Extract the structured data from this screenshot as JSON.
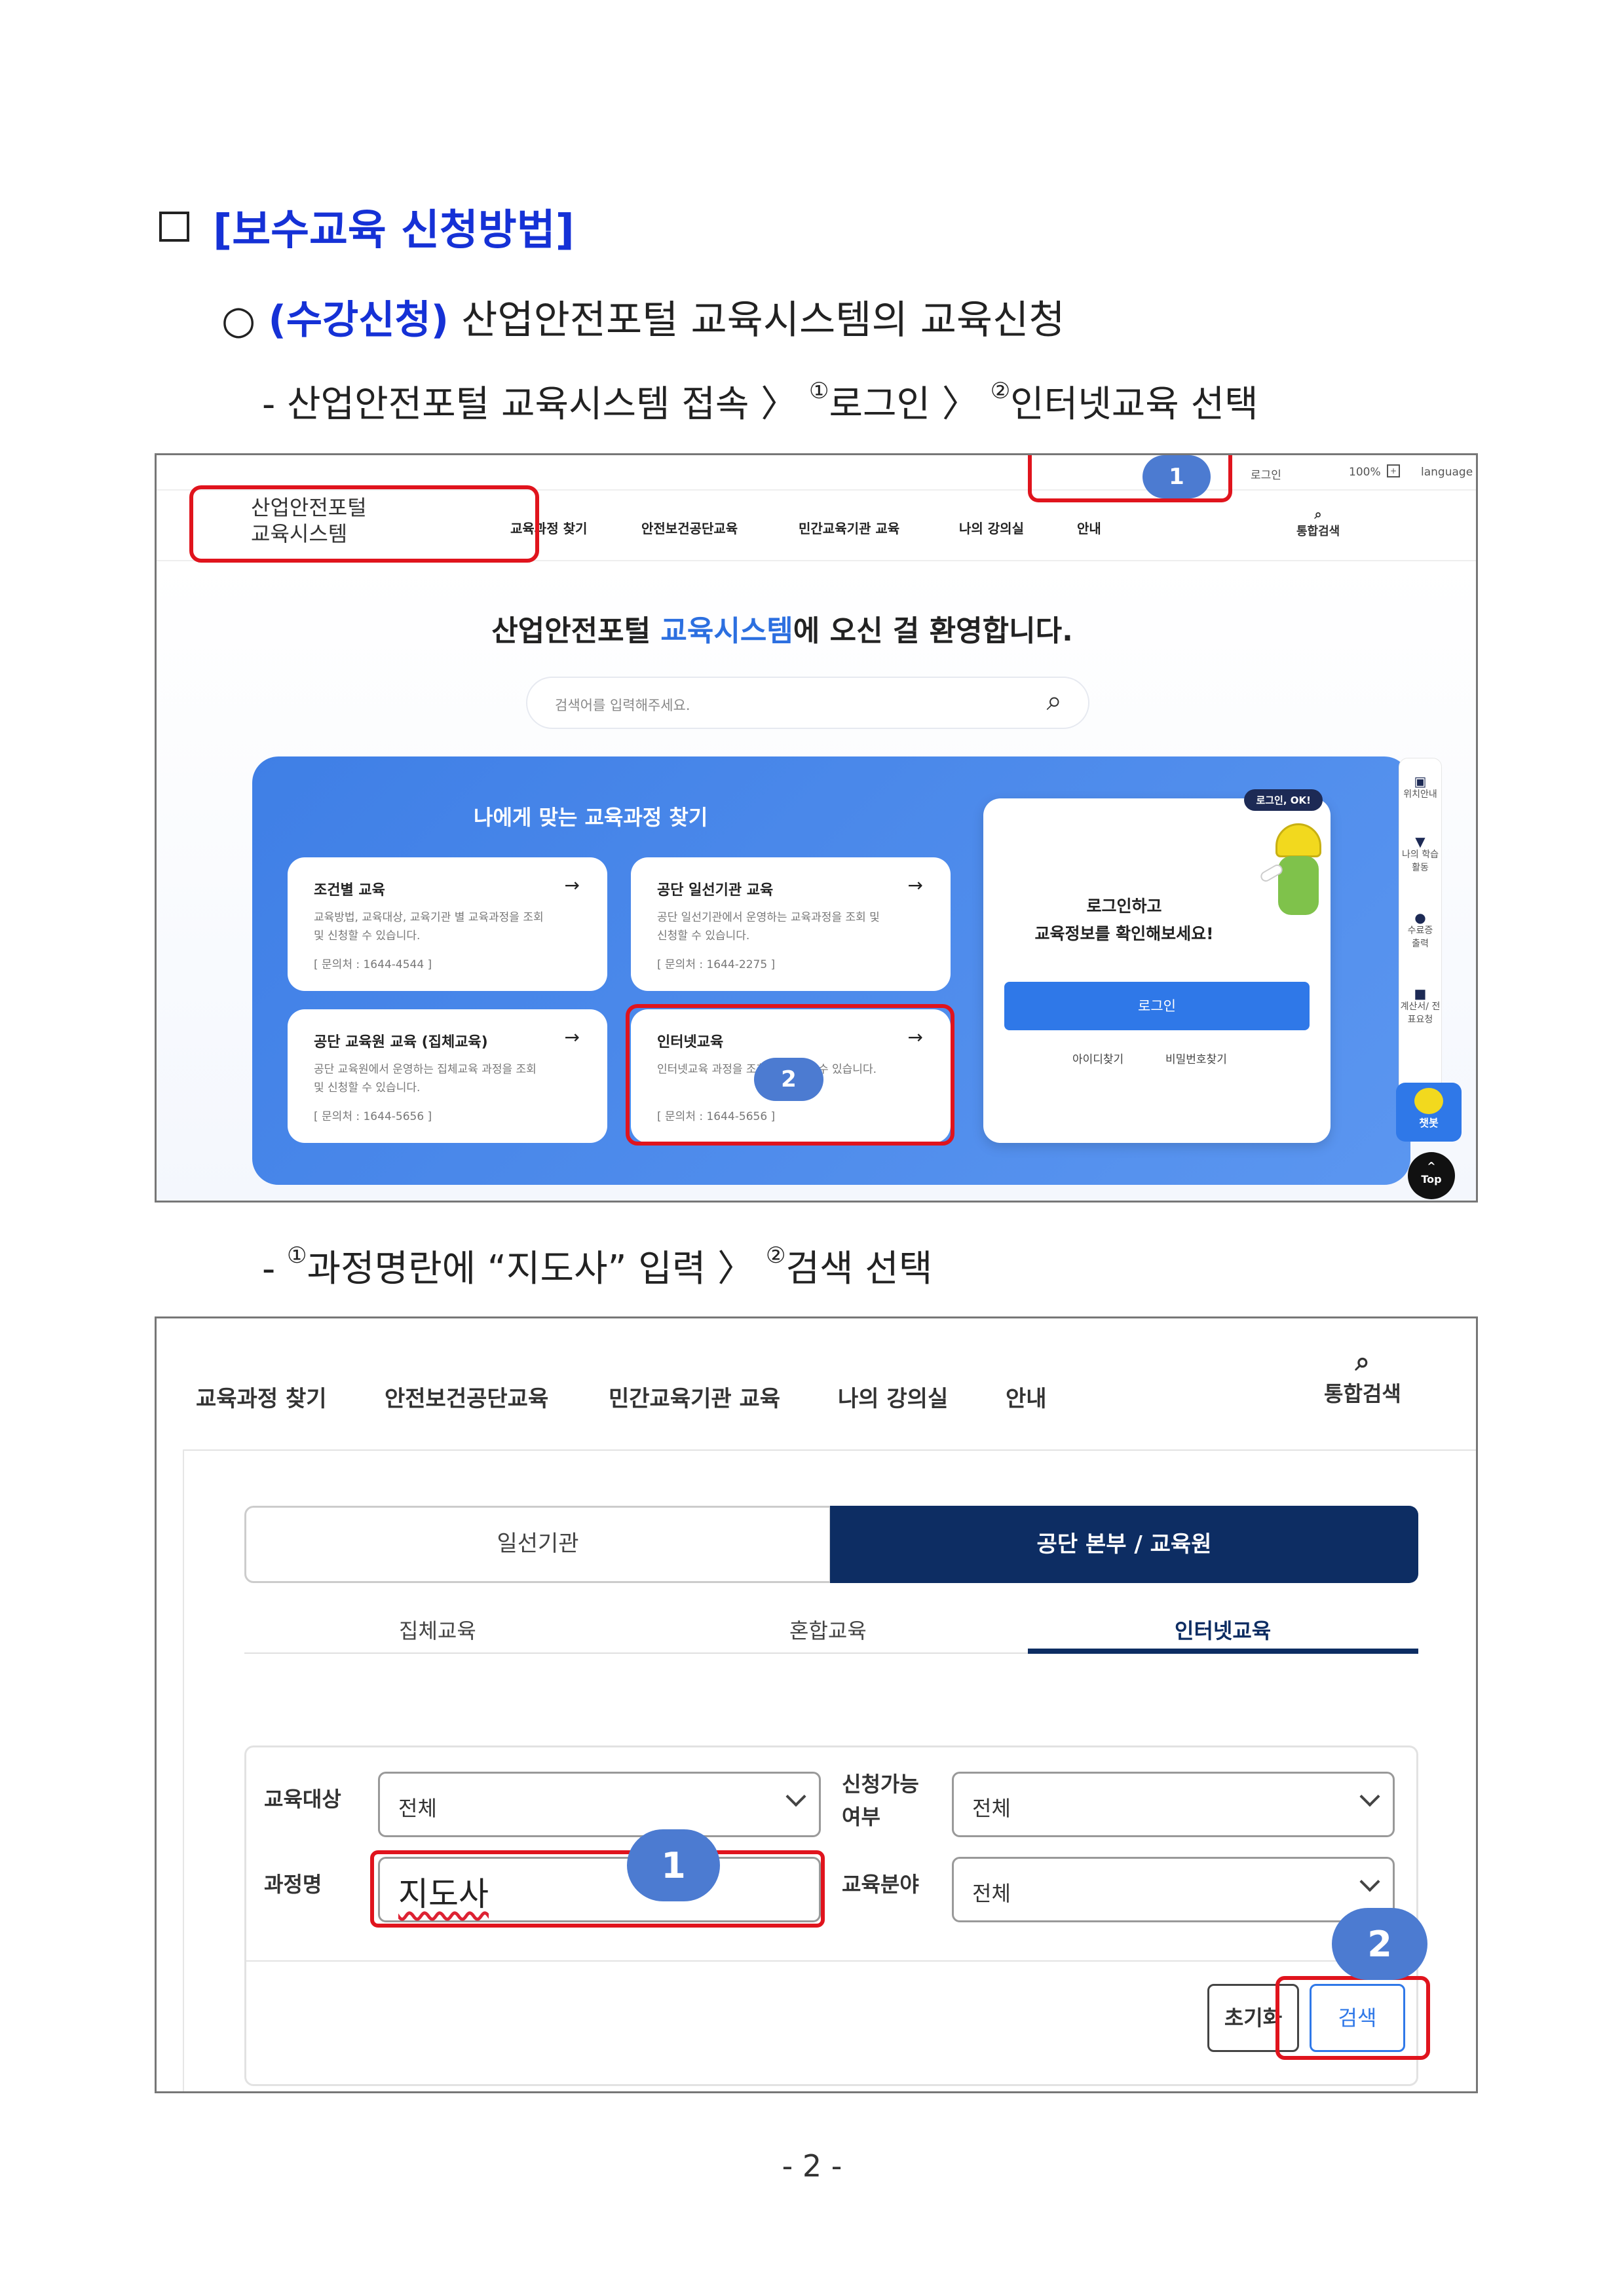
{
  "heading1": {
    "text": "[보수교육 신청방법]"
  },
  "heading2": {
    "prefix": "(수강신청)",
    "text": "산업안전포털 교육시스템의 교육신청"
  },
  "step1": {
    "dash": "-",
    "text1": "산업안전포털 교육시스템 접속 〉",
    "sup1": "①",
    "text2": "로그인 〉",
    "sup2": "②",
    "text3": "인터넷교육 선택"
  },
  "step2": {
    "dash": "-",
    "sup1": "①",
    "text1": "과정명란에 “지도사” 입력 〉",
    "sup2": "②",
    "text2": "검색 선택"
  },
  "screen1": {
    "logo": [
      "산업안전포털",
      "교육시스템"
    ],
    "top_links": {
      "login": "로그인",
      "zoom": "100%",
      "language": "language"
    },
    "nav": [
      "교육과정 찾기",
      "안전보건공단교육",
      "민간교육기관 교육",
      "나의 강의실",
      "안내"
    ],
    "search_label": "통합검색",
    "welcome": {
      "part1": "산업안전포털 ",
      "highlight": "교육시스템",
      "part2": "에 오신 걸 환영합니다."
    },
    "search_placeholder": "검색어를 입력해주세요.",
    "panel_title": "나에게 맞는 교육과정 찾기",
    "cards": [
      {
        "title": "조건별 교육",
        "desc": "교육방법, 교육대상, 교육기관 별 교육과정을 조회및 신청할 수 있습니다.",
        "contact": "[ 문의처 : 1644-4544 ]"
      },
      {
        "title": "공단 일선기관 교육",
        "desc": "공단 일선기관에서 운영하는 교육과정을 조회 및 신청할 수 있습니다.",
        "contact": "[ 문의처 : 1644-2275 ]"
      },
      {
        "title": "공단 교육원 교육 (집체교육)",
        "desc": "공단 교육원에서 운영하는 집체교육 과정을 조회 및 신청할 수 있습니다.",
        "contact": "[ 문의처 : 1644-5656 ]"
      },
      {
        "title": "인터넷교육",
        "desc": "인터넷교육 과정을 조회 및 신청할 수 있습니다.",
        "contact": "[ 문의처 : 1644-5656 ]"
      }
    ],
    "login_card": {
      "bubble": "로그인, OK!",
      "msg1": "로그인하고",
      "msg2": "교육정보를 확인해보세요!",
      "button": "로그인",
      "find_id": "아이디찾기",
      "find_pw": "비밀번호찾기"
    },
    "side": [
      "위치안내",
      "나의 학습활동",
      "수료증 출력",
      "계산서/ 전표요청",
      "챗봇",
      "Top"
    ],
    "badges": [
      "1",
      "2"
    ],
    "arrow": "→"
  },
  "screen2": {
    "nav": [
      "교육과정 찾기",
      "안전보건공단교육",
      "민간교육기관 교육",
      "나의 강의실",
      "안내"
    ],
    "search_label": "통합검색",
    "org_tabs": [
      "일선기관",
      "공단 본부 / 교육원"
    ],
    "type_tabs": [
      "집체교육",
      "혼합교육",
      "인터넷교육"
    ],
    "filters": {
      "target_label": "교육대상",
      "target_value": "전체",
      "avail_label": "신청가능 여부",
      "avail_value": "전체",
      "course_label": "과정명",
      "course_value": "지도사",
      "field_label": "교육분야",
      "field_value": "전체"
    },
    "buttons": {
      "reset": "초기화",
      "search": "검색"
    },
    "badges": [
      "1",
      "2"
    ]
  },
  "footer": {
    "page": "- 2 -"
  },
  "colors": {
    "heading_blue": "#1531d6",
    "panel_blue": "#4a86ec",
    "navy": "#0d2d63",
    "highlight_red": "#e0141d",
    "badge_blue": "#4c7bd1"
  }
}
